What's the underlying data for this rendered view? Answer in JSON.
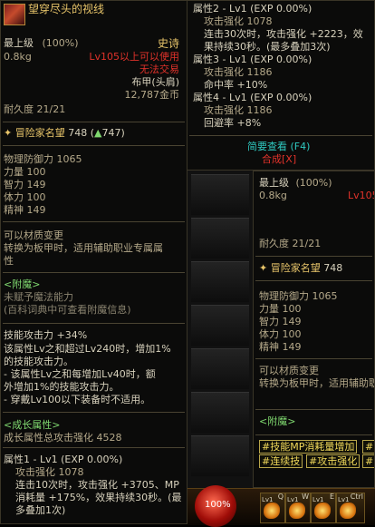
{
  "left_tooltip": {
    "title": "望穿尽头的视线",
    "grade": "最上级",
    "grade_pct": "(100%)",
    "rarity": "史诗",
    "weight": "0.8kg",
    "level_req": "Lv105以上可以使用",
    "trade": "无法交易",
    "slot": "布甲(头肩)",
    "price": "12,787金币",
    "durability": "耐久度 21/21",
    "fame_label": "冒险家名望",
    "fame_value": "748",
    "fame_change": "747",
    "phys_def": "物理防御力 1065",
    "str": "力量 100",
    "int": "智力 149",
    "vit": "体力 100",
    "spi": "精神 149",
    "material_change_1": "可以材质变更",
    "material_change_2": "转换为板甲时，适用辅助职业专属属",
    "material_change_3": "性",
    "enchant_header": "<附魔>",
    "enchant_none": "未赋予魔法能力",
    "enchant_hint": "(百科词典中可查看附魔信息)",
    "skill_attack": "技能攻击力 +34%",
    "desc_1": "该属性Lv之和超过Lv240时，增加1%",
    "desc_2": "的技能攻击力。",
    "desc_3": "- 该属性Lv之和每增加Lv40时，额",
    "desc_4": "外增加1%的技能攻击力。",
    "desc_5": "- 穿戴Lv100以下装备时不适用。",
    "growth_header": "<成长属性>",
    "growth_total": "成长属性总攻击强化 4528",
    "attr1_title": "属性1 - Lv1 (EXP 0.00%)",
    "attr1_atk": "攻击强化 1078",
    "attr1_l1": "连击10次时，攻击强化 +3705、MP",
    "attr1_l2": "消耗量 +175%，效果持续30秒。(最",
    "attr1_l3": "多叠加1次)"
  },
  "right_top": {
    "attr2_title": "属性2 - Lv1 (EXP 0.00%)",
    "attr2_atk": "攻击强化 1078",
    "attr2_l1": "连击30次时，攻击强化 +2223，效",
    "attr2_l2": "果持续30秒。(最多叠加3次)",
    "attr3_title": "属性3 - Lv1 (EXP 0.00%)",
    "attr3_atk": "攻击强化 1186",
    "attr3_l1": "命中率 +10%",
    "attr4_title": "属性4 - Lv1 (EXP 0.00%)",
    "attr4_atk": "攻击强化 1186",
    "attr4_l1": "回避率 +8%",
    "brief_view": "简要查看 (F4)",
    "compose": "合成[X]"
  },
  "right_tooltip": {
    "grade": "最上级",
    "grade_pct": "(100%)",
    "weight": "0.8kg",
    "level_req": "Lv105",
    "durability": "耐久度 21/21",
    "fame_label": "冒险家名望",
    "fame_value": "748",
    "phys_def": "物理防御力 1065",
    "str": "力量 100",
    "int": "智力 149",
    "vit": "体力 100",
    "spi": "精神 149",
    "material_change_1": "可以材质变更",
    "material_change_2": "转换为板甲时，适用辅助职",
    "enchant_header": "<附魔>",
    "tags": [
      "#技能MP消耗量增加",
      "#?",
      "#连续技",
      "#攻击强化",
      "#?"
    ]
  },
  "hud": {
    "hp_pct": "100%",
    "keys": [
      "Q",
      "W",
      "E",
      "Ctrl"
    ],
    "slot_levels": [
      "Lv1",
      "Lv1",
      "Lv1",
      "Lv1"
    ]
  }
}
